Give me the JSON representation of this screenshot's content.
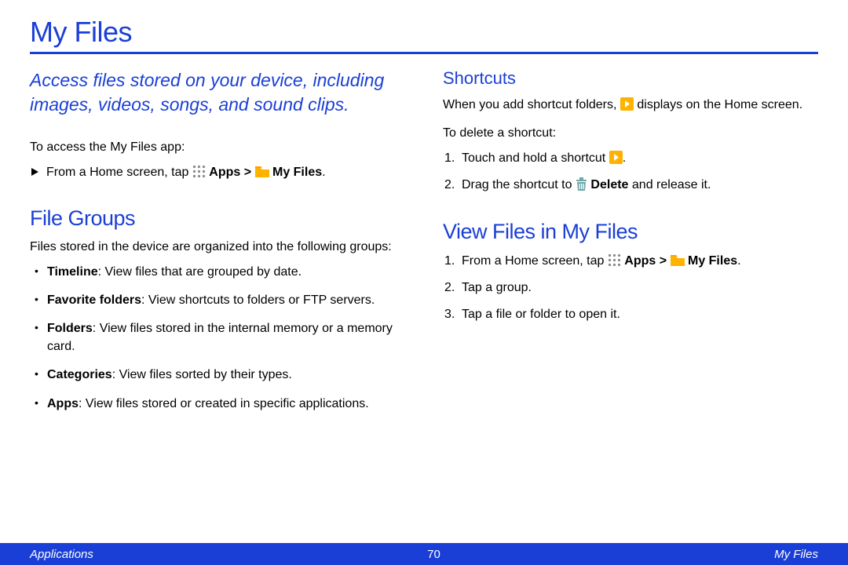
{
  "page_title": "My Files",
  "intro": "Access files stored on your device, including images, videos, songs, and sound clips.",
  "access_label": "To access the My Files app:",
  "access_step_prefix": "From a Home screen, tap ",
  "apps_label": "Apps",
  "myfiles_label": "My Files",
  "gt": " > ",
  "period": ".",
  "file_groups_heading": "File Groups",
  "file_groups_intro": "Files stored in the device are organized into the following groups:",
  "groups": [
    {
      "name": "Timeline",
      "desc": ": View files that are grouped by date."
    },
    {
      "name": "Favorite folders",
      "desc": ": View shortcuts to folders or FTP servers."
    },
    {
      "name": "Folders",
      "desc": ": View files stored in the internal memory or a memory card."
    },
    {
      "name": "Categories",
      "desc": ": View files sorted by their types."
    },
    {
      "name": "Apps",
      "desc": ": View files stored or created in specific applications."
    }
  ],
  "shortcuts_heading": "Shortcuts",
  "shortcuts_text1a": "When you add shortcut folders, ",
  "shortcuts_text1b": " displays on the Home screen.",
  "shortcuts_delete_label": "To delete a shortcut:",
  "shortcut_step1": "Touch and hold a shortcut ",
  "shortcut_step2a": "Drag the shortcut to ",
  "delete_label": "Delete",
  "shortcut_step2b": " and release it.",
  "view_heading": "View Files in My Files",
  "view_step1_prefix": "From a Home screen, tap ",
  "view_step2": "Tap a group.",
  "view_step3": "Tap a file or folder to open it.",
  "footer_left": "Applications",
  "footer_center": "70",
  "footer_right": "My Files"
}
